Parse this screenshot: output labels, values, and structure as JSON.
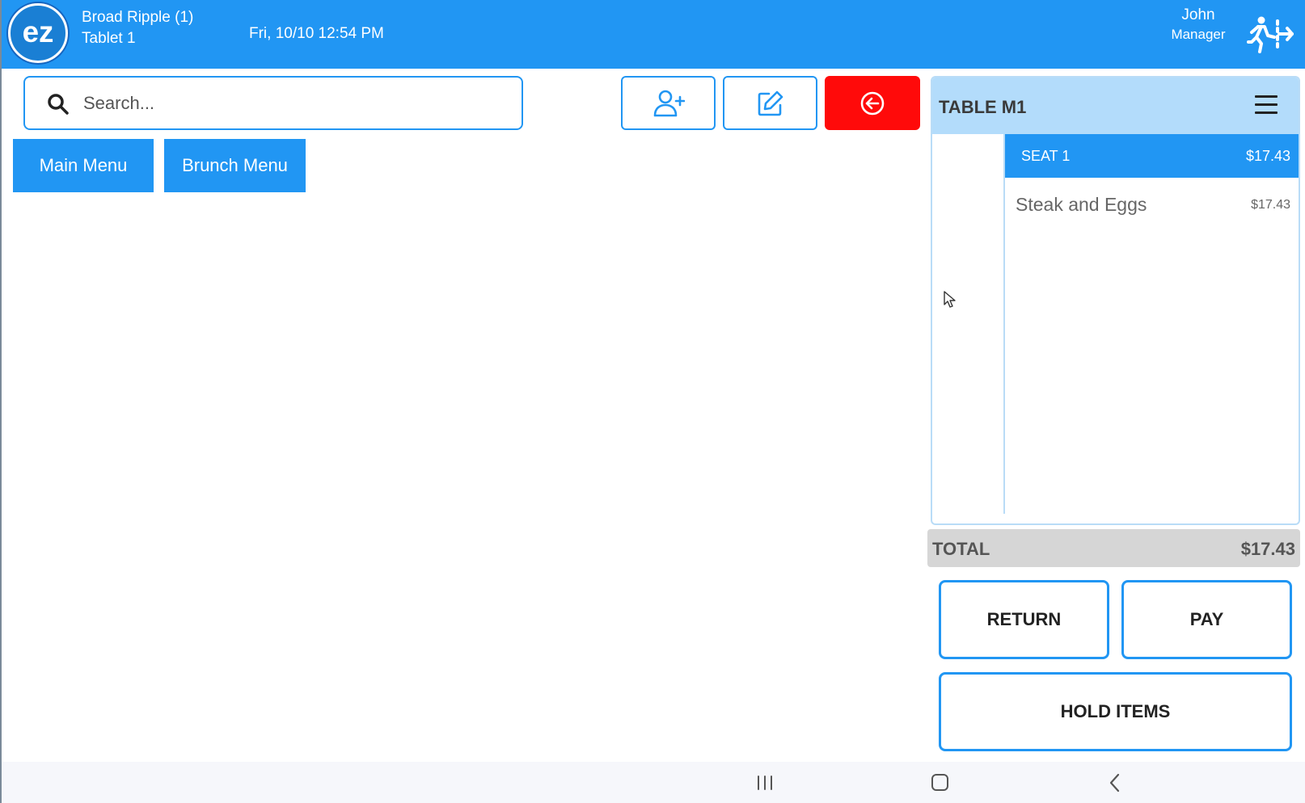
{
  "header": {
    "logo_text": "ez",
    "location": "Broad Ripple (1)",
    "device": "Tablet 1",
    "datetime": "Fri, 10/10 12:54 PM",
    "user_name": "John",
    "user_role": "Manager",
    "logout_icon": "logout-icon"
  },
  "search": {
    "placeholder": "Search...",
    "value": "",
    "icon": "search-icon"
  },
  "toolbar": {
    "add_customer_icon": "add-user-icon",
    "edit_icon": "edit-icon",
    "back_icon": "circle-arrow-left-icon"
  },
  "menu_tabs": [
    {
      "label": "Main Menu"
    },
    {
      "label": "Brunch Menu"
    }
  ],
  "ticket": {
    "title": "TABLE M1",
    "menu_icon": "hamburger-menu-icon",
    "seats": [
      {
        "label": "SEAT 1",
        "amount": "$17.43",
        "items": [
          {
            "name": "Steak and Eggs",
            "price": "$17.43"
          }
        ]
      }
    ],
    "total_label": "TOTAL",
    "total_amount": "$17.43"
  },
  "actions": {
    "return_label": "RETURN",
    "pay_label": "PAY",
    "hold_label": "HOLD ITEMS"
  },
  "colors": {
    "primary": "#2196f3",
    "danger": "#ff0a0a",
    "seat_header": "#b3dcfb",
    "total_bg": "#d6d6d6"
  },
  "system_nav": {
    "recent_icon": "recent-apps-icon",
    "home_icon": "home-icon",
    "back_icon": "back-icon"
  }
}
